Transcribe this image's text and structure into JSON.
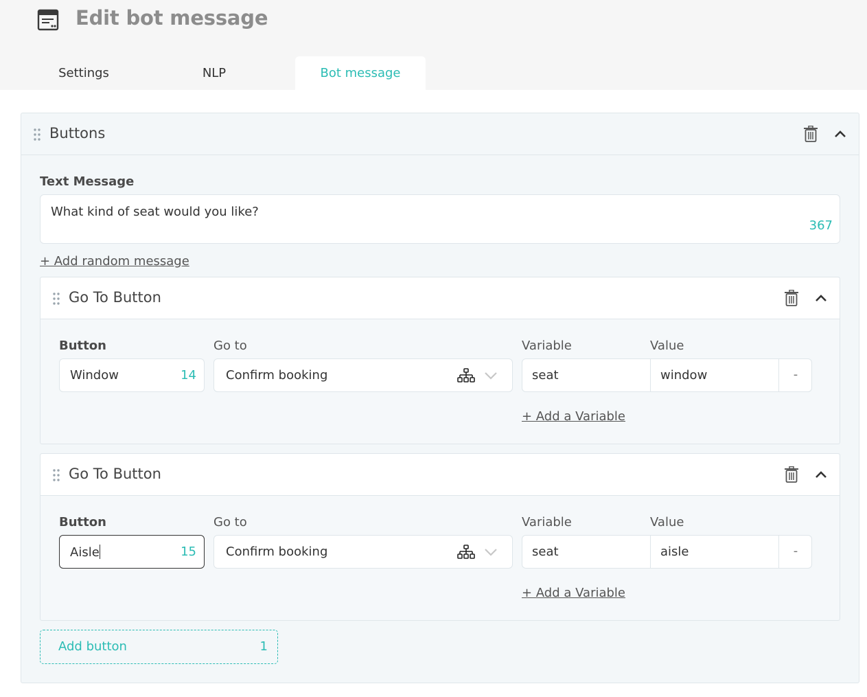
{
  "header": {
    "title": "Edit bot message",
    "icon": "message-window-icon"
  },
  "tabs": [
    {
      "label": "Settings",
      "active": false
    },
    {
      "label": "NLP",
      "active": false
    },
    {
      "label": "Bot message",
      "active": true
    }
  ],
  "buttons_block": {
    "title": "Buttons",
    "text_message_label": "Text Message",
    "text_message_value": "What kind of seat would you like?",
    "text_message_counter": "367",
    "add_random_message": "+ Add random message",
    "cards": [
      {
        "title": "Go To Button",
        "button_label": "Button",
        "button_value": "Window",
        "button_counter": "14",
        "goto_label": "Go to",
        "goto_value": "Confirm booking",
        "variable_label": "Variable",
        "value_label": "Value",
        "variable_value": "seat",
        "value_value": "window",
        "remove_label": "-",
        "add_variable": "+ Add a Variable"
      },
      {
        "title": "Go To Button",
        "button_label": "Button",
        "button_value": "Aisle",
        "button_counter": "15",
        "goto_label": "Go to",
        "goto_value": "Confirm booking",
        "variable_label": "Variable",
        "value_label": "Value",
        "variable_value": "seat",
        "value_value": "aisle",
        "remove_label": "-",
        "add_variable": "+ Add a Variable"
      }
    ],
    "add_button_label": "Add button",
    "add_button_counter": "1"
  },
  "colors": {
    "accent": "#2bbcb4",
    "panel_bg": "#f3f7f9",
    "border": "#dfe6ea"
  }
}
